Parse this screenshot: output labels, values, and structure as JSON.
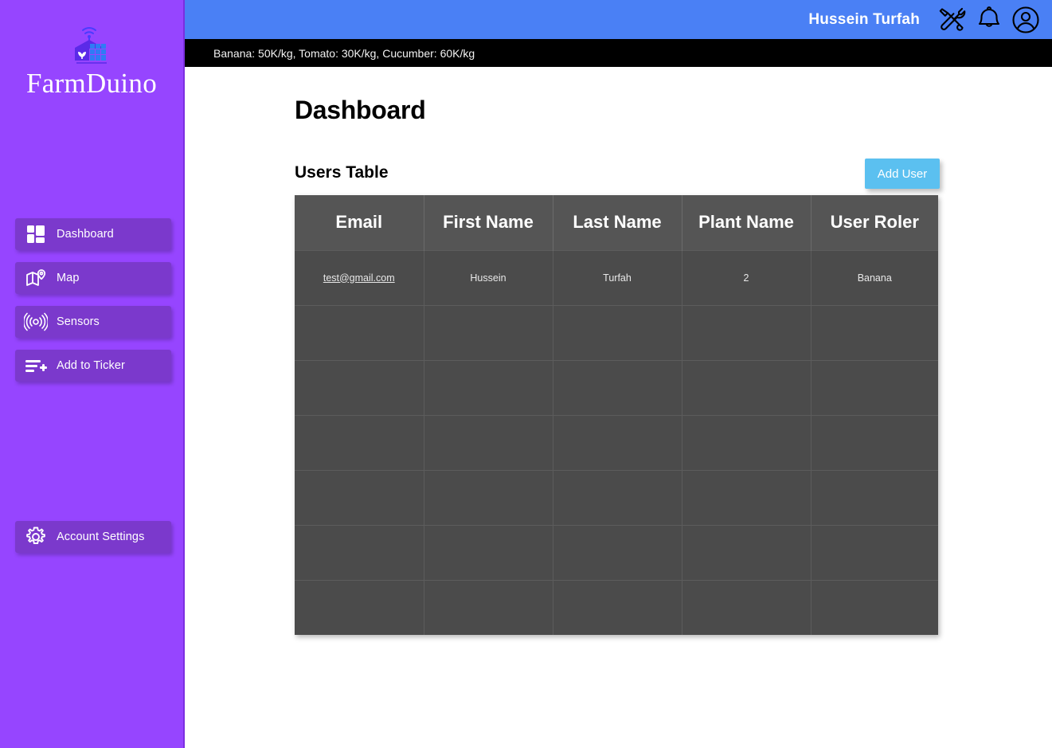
{
  "brand": {
    "name": "FarmDuino",
    "logo_icon": "greenhouse-wifi-logo"
  },
  "sidebar": {
    "items": [
      {
        "label": "Dashboard",
        "icon": "dashboard-grid-icon"
      },
      {
        "label": "Map",
        "icon": "map-pin-icon"
      },
      {
        "label": "Sensors",
        "icon": "signal-waves-icon"
      },
      {
        "label": "Add to Ticker",
        "icon": "list-plus-icon"
      }
    ],
    "settings": {
      "label": "Account Settings",
      "icon": "gear-icon"
    }
  },
  "topbar": {
    "user_name": "Hussein Turfah",
    "icons": [
      {
        "name": "tools-icon"
      },
      {
        "name": "bell-icon"
      },
      {
        "name": "user-account-icon"
      }
    ],
    "background_color": "#4A80F5"
  },
  "ticker": {
    "text": "Banana: 50K/kg, Tomato: 30K/kg, Cucumber: 60K/kg",
    "background_color": "#000000"
  },
  "main": {
    "page_title": "Dashboard",
    "table_title": "Users Table",
    "add_user_label": "Add User",
    "add_user_color": "#5BC0F0",
    "table": {
      "headers": [
        "Email",
        "First Name",
        "Last Name",
        "Plant Name",
        "User Roler"
      ],
      "rows": [
        {
          "email": "test@gmail.com",
          "first_name": "Hussein",
          "last_name": "Turfah",
          "plant_name": "2",
          "user_role": "Banana"
        },
        {
          "email": "",
          "first_name": "",
          "last_name": "",
          "plant_name": "",
          "user_role": ""
        },
        {
          "email": "",
          "first_name": "",
          "last_name": "",
          "plant_name": "",
          "user_role": ""
        },
        {
          "email": "",
          "first_name": "",
          "last_name": "",
          "plant_name": "",
          "user_role": ""
        },
        {
          "email": "",
          "first_name": "",
          "last_name": "",
          "plant_name": "",
          "user_role": ""
        },
        {
          "email": "",
          "first_name": "",
          "last_name": "",
          "plant_name": "",
          "user_role": ""
        },
        {
          "email": "",
          "first_name": "",
          "last_name": "",
          "plant_name": "",
          "user_role": ""
        }
      ],
      "header_color": "#555555",
      "cell_color": "#4B4B4B"
    }
  },
  "theme": {
    "sidebar_color": "#9645FF",
    "sidebar_item_color": "#7B39CC"
  }
}
